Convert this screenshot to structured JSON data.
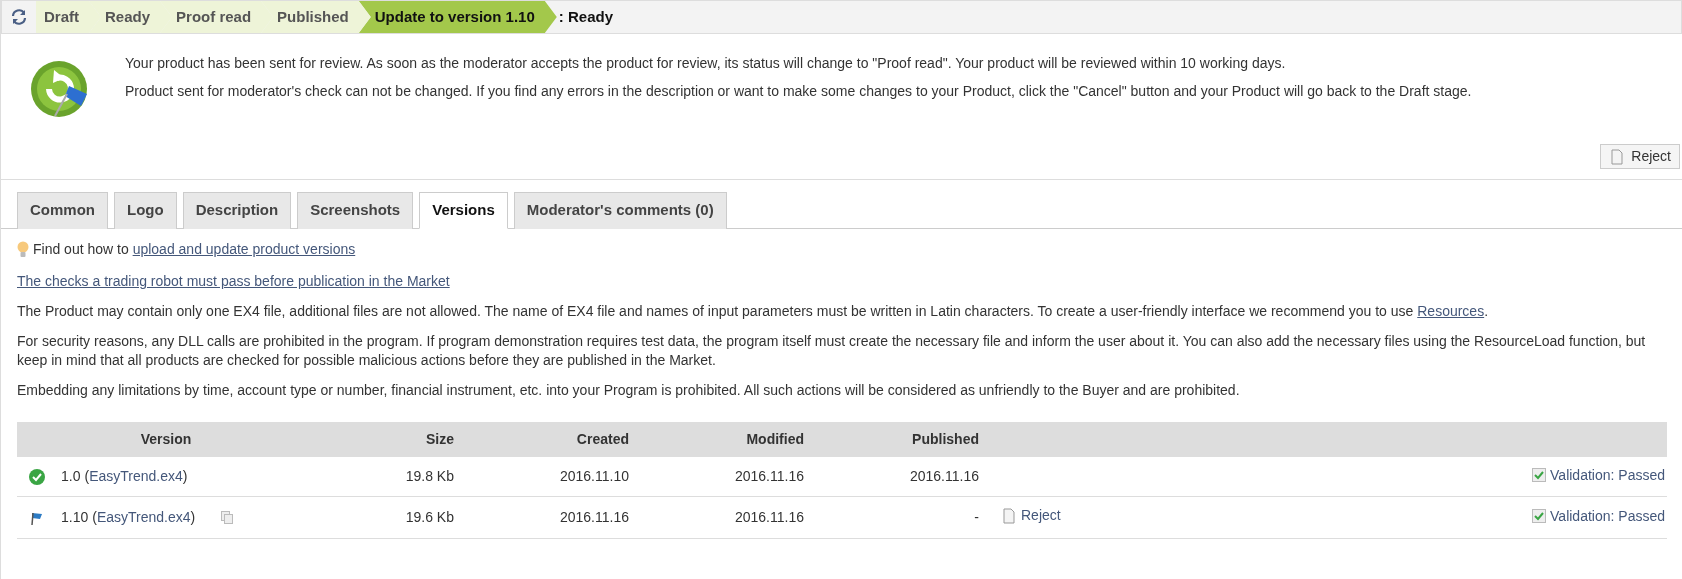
{
  "steps": [
    {
      "label": "Draft",
      "kind": "done"
    },
    {
      "label": "Ready",
      "kind": "done"
    },
    {
      "label": "Proof read",
      "kind": "done"
    },
    {
      "label": "Published",
      "kind": "done"
    },
    {
      "label": "Update to version 1.10",
      "kind": "current",
      "suffix": ": Ready"
    }
  ],
  "notice": {
    "paragraphs": [
      "Your product has been sent for review. As soon as the moderator accepts the product for review, its status will change to \"Proof read\". Your product will be reviewed within 10 working days.",
      "Product sent for moderator's check can not be changed. If you find any errors in the description or want to make some changes to your Product, click the \"Cancel\" button and your Product will go back to the Draft stage."
    ],
    "button": "Reject"
  },
  "tabs": [
    {
      "label": "Common",
      "selected": false
    },
    {
      "label": "Logo",
      "selected": false
    },
    {
      "label": "Description",
      "selected": false
    },
    {
      "label": "Screenshots",
      "selected": false
    },
    {
      "label": "Versions",
      "selected": true
    },
    {
      "label": "Moderator's comments (0)",
      "selected": false
    }
  ],
  "hint": {
    "text": "Find out how to ",
    "link": "upload and update product versions"
  },
  "checks_link": "The checks a trading robot must pass before publication in the Market",
  "paragraphs": [
    {
      "text": "The Product may contain only one EX4 file, additional files are not allowed. The name of EX4 file and names of input parameters must be written in Latin characters. To create a user-friendly interface we recommend you to use ",
      "link": "Resources",
      "after": "."
    },
    {
      "text": "For security reasons, any DLL calls are prohibited in the program. If program demonstration requires test data, the program itself must create the necessary file and inform the user about it. You can also add the necessary files using the ResourceLoad function, but keep in mind that all products are checked for possible malicious actions before they are published in the Market."
    },
    {
      "text": "Embedding any limitations by time, account type or number, financial instrument, etc. into your Program is prohibited. All such actions will be considered as unfriendly to the Buyer and are prohibited."
    }
  ],
  "table": {
    "columns": [
      "Version",
      "Size",
      "Created",
      "Modified",
      "Published"
    ],
    "rows": [
      {
        "kind": "published",
        "version": "1.0",
        "paren_open": "(",
        "file": "EasyTrend.ex4",
        "paren_close": ")",
        "copyable": false,
        "size": "19.8 Kb",
        "created": "2016.11.10",
        "modified": "2016.11.16",
        "published": "2016.11.16",
        "validation": "Validation: Passed"
      },
      {
        "kind": "pending",
        "version": "1.10",
        "paren_open": "(",
        "file": "EasyTrend.ex4",
        "paren_close": ")",
        "copyable": true,
        "size": "19.6 Kb",
        "created": "2016.11.16",
        "modified": "2016.11.16",
        "published": "-",
        "action": "Reject",
        "validation": "Validation: Passed"
      }
    ]
  }
}
